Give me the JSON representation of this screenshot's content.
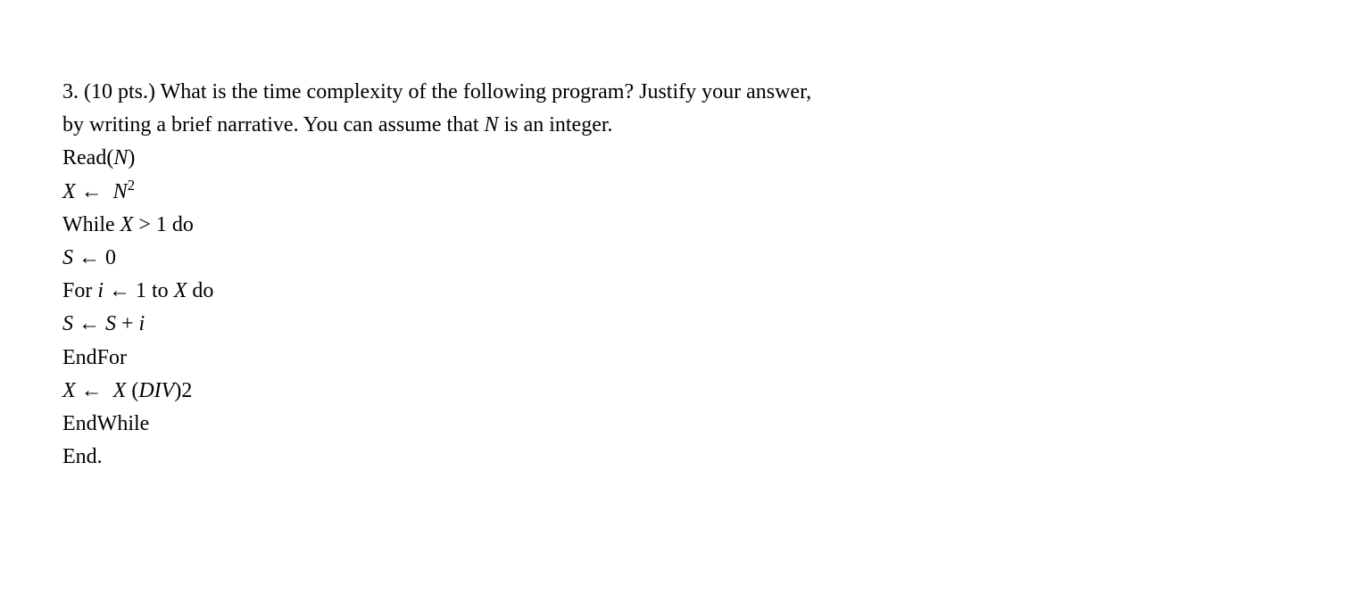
{
  "question": {
    "number": "3.",
    "points": "(10 pts.)",
    "prompt_part1": "What is the time complexity of the following program? Justify your answer,",
    "prompt_part2": "by writing a brief narrative. You can assume that ",
    "var_N": "N",
    "prompt_part3": " is an integer.",
    "pseudocode": {
      "line1_read": "Read(",
      "line1_var": "N",
      "line1_close": ")",
      "line2_X": "X",
      "line2_arrow": " ← ",
      "line2_N": "N",
      "line2_sup": "2",
      "line3_while": "While ",
      "line3_X": "X",
      "line3_cond": " > 1 do",
      "line4_S": "S",
      "line4_arrow": " ← ",
      "line4_val": "0",
      "line5_for": "For ",
      "line5_i": "i",
      "line5_arrow": " ← ",
      "line5_one": "1 to ",
      "line5_X": "X",
      "line5_do": " do",
      "line6_S": "S",
      "line6_arrow": " ← ",
      "line6_S2": "S",
      "line6_plus": " + ",
      "line6_i": "i",
      "line7": "EndFor",
      "line8_X": "X",
      "line8_arrow": " ← ",
      "line8_X2": " X ",
      "line8_open": "(",
      "line8_DIV": "DIV",
      "line8_close": ")",
      "line8_two": "2",
      "line9": "EndWhile",
      "line10": "End."
    }
  }
}
